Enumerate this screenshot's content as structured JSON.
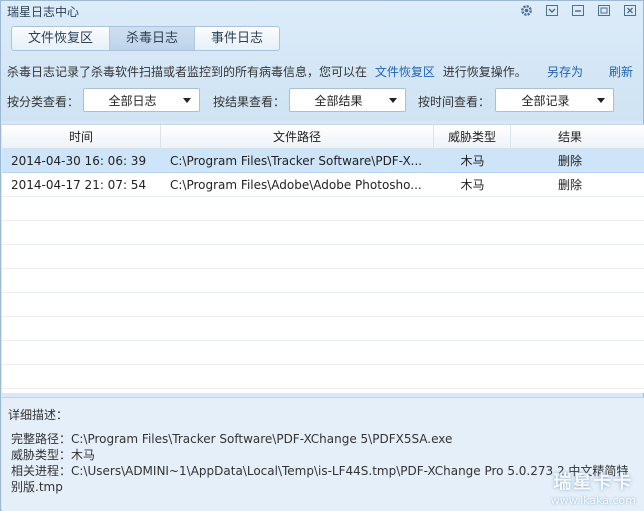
{
  "window": {
    "title": "瑞星日志中心",
    "controls": [
      "gear-icon",
      "menu-icon",
      "minimize-icon",
      "maximize-icon",
      "close-icon"
    ]
  },
  "tabs": [
    {
      "label": "文件恢复区",
      "active": false
    },
    {
      "label": "杀毒日志",
      "active": true
    },
    {
      "label": "事件日志",
      "active": false
    }
  ],
  "info": {
    "text_before": "杀毒日志记录了杀毒软件扫描或者监控到的所有病毒信息，您可以在",
    "link": "文件恢复区",
    "text_after": "进行恢复操作。",
    "save_as": "另存为",
    "refresh": "刷新"
  },
  "filters": {
    "category_label": "按分类查看：",
    "category_value": "全部日志",
    "result_label": "按结果查看：",
    "result_value": "全部结果",
    "time_label": "按时间查看：",
    "time_value": "全部记录"
  },
  "table": {
    "headers": {
      "time": "时间",
      "path": "文件路径",
      "type": "威胁类型",
      "result": "结果"
    },
    "rows": [
      {
        "time": "2014-04-30 16: 06: 39",
        "path": "C:\\Program Files\\Tracker Software\\PDF-X...",
        "type": "木马",
        "result": "删除",
        "selected": true
      },
      {
        "time": "2014-04-17 21: 07: 54",
        "path": "C:\\Program Files\\Adobe\\Adobe Photosho...",
        "type": "木马",
        "result": "删除",
        "selected": false
      }
    ]
  },
  "detail": {
    "heading": "详细描述：",
    "path_line": "完整路径：C:\\Program Files\\Tracker Software\\PDF-XChange 5\\PDFX5SA.exe",
    "type_line": "威胁类型：木马",
    "process_line1": "相关进程：C:\\Users\\ADMINI~1\\AppData\\Local\\Temp\\is-LF44S.tmp\\PDF-XChange  Pro  5.0.273.2 中文精简特",
    "process_line2": "别版.tmp"
  },
  "watermark": {
    "big": "瑞星卡卡",
    "small": "www.ikaka.com"
  }
}
